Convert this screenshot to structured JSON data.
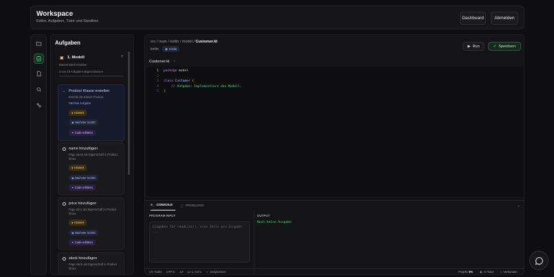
{
  "header": {
    "title": "Workspace",
    "subtitle": "Editor, Aufgaben, Tutor und Sandbox",
    "dashboard_label": "Dashboard",
    "logout_label": "Abmelden"
  },
  "rail": {
    "icons": [
      "folder-icon",
      "clipboard-check-icon",
      "file-icon",
      "search-icon",
      "link-icon"
    ],
    "active_index": 1
  },
  "tasks": {
    "title": "Aufgaben",
    "module": {
      "title": "1. Modell",
      "subtitle": "Datenmodell erstellen.",
      "progress_text": "0 von 10 Aufgaben abgeschlossen",
      "progress": 0
    },
    "items": [
      {
        "title": "Product Klasse erstellen",
        "desc": "Erstelle die Klasse Product.",
        "link": "Nächste Aufgabe",
        "hint": "Hinweis",
        "next": "Nächster Schritt",
        "explain": "Code erklären"
      },
      {
        "title": "name hinzufügen",
        "desc": "Füge name als Eigenschaft in Product hinzu.",
        "hint": "Hinweis",
        "next": "Nächster Schritt",
        "explain": "Code erklären"
      },
      {
        "title": "price hinzufügen",
        "desc": "Füge price als Eigenschaft in Product hinzu.",
        "hint": "Hinweis",
        "next": "Nächster Schritt",
        "explain": "Code erklären"
      },
      {
        "title": "stock hinzufügen",
        "desc": "Füge stock als Eigenschaft in Product hinzu."
      }
    ]
  },
  "editor": {
    "breadcrumb": [
      "src",
      "main",
      "kotlin",
      "model"
    ],
    "file": "Customer.kt",
    "language": "kotlin",
    "language_badge": "Kotlin",
    "run_label": "Run",
    "save_label": "Speichern",
    "tab_label": "Customer.kt",
    "tab_close": "×",
    "line_numbers": [
      "1",
      "2",
      "3",
      "4",
      "5"
    ]
  },
  "console": {
    "tab_console": "CONSOLE",
    "tab_problems": "PROBLEMS",
    "input_label": "PROGRAM INPUT",
    "input_placeholder": "Eingaben für readLine(), eine Zeile pro Eingabe ...",
    "output_label": "OUTPUT",
    "output_text": "Noch keine Ausgabe."
  },
  "status": {
    "language": "Kotlin",
    "encoding": "UTF-8",
    "eol": "LF",
    "position": "Ln 1, Col 1",
    "saved": "Gespeichert",
    "project_label": "Projekt",
    "project_value": "0%",
    "tutor": "AI Tutor",
    "connection": "Verbunden"
  },
  "colors": {
    "accent_green": "#4ade80",
    "keyword": "#c084fc",
    "type": "#7dd3fc",
    "hint": "#f5d37a"
  }
}
